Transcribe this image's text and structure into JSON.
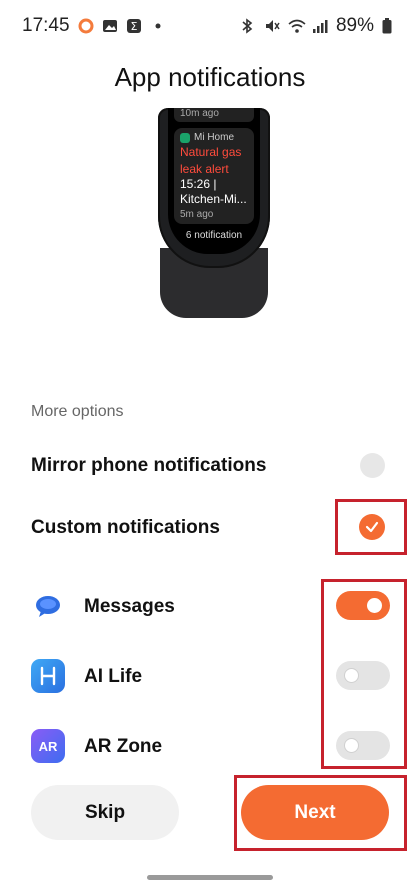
{
  "status_bar": {
    "time": "17:45",
    "battery": "89%",
    "icons_left": [
      "record-circle-icon",
      "gallery-icon",
      "sigma-app-icon",
      "dot-icon"
    ],
    "icons_right": [
      "bluetooth-icon",
      "mute-icon",
      "wifi-icon",
      "signal-icon",
      "battery-icon"
    ]
  },
  "header": {
    "title": "App notifications"
  },
  "band_preview": {
    "top_card_time": "10m ago",
    "app_name": "Mi Home",
    "alert_text": [
      "Natural gas",
      "leak alert"
    ],
    "detail_text": [
      "15:26 |",
      "Kitchen-Mi..."
    ],
    "time_ago": "5m ago",
    "count_text": "6 notification"
  },
  "options": {
    "section_label": "More options",
    "mirror_label": "Mirror phone notifications",
    "mirror_selected": false,
    "custom_label": "Custom notifications",
    "custom_selected": true
  },
  "apps": [
    {
      "name": "Messages",
      "icon": "messages-icon",
      "enabled": true,
      "color": "#2f6de1"
    },
    {
      "name": "AI Life",
      "icon": "ai-life-icon",
      "enabled": false,
      "color": "#2f8ff0"
    },
    {
      "name": "AR Zone",
      "icon": "ar-zone-icon",
      "icon_text": "AR",
      "enabled": false,
      "color": "#6a55e8"
    }
  ],
  "buttons": {
    "skip": "Skip",
    "next": "Next"
  },
  "colors": {
    "accent": "#f46b32",
    "highlight": "#c6222d"
  }
}
